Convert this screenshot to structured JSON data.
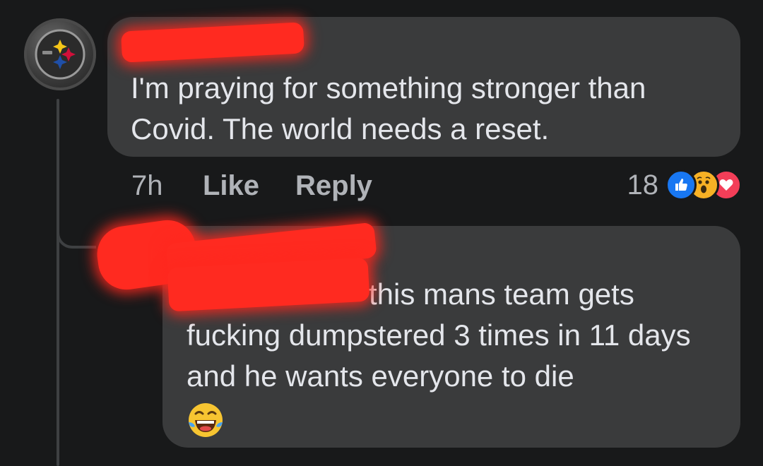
{
  "comment": {
    "author": "",
    "text": "I'm praying for something stronger than Covid. The world needs a reset.",
    "time": "7h",
    "like_label": "Like",
    "reply_label": "Reply",
    "reaction_count": "18",
    "reactions": [
      "like-icon",
      "wow-icon",
      "love-icon"
    ]
  },
  "reply": {
    "author": "",
    "mention": "",
    "text": "this mans team gets fucking dumpstered 3 times in 11 days and he wants everyone to die",
    "emoji": "laughing-tears-emoji"
  },
  "colors": {
    "background": "#18191a",
    "bubble": "#3a3b3c",
    "text": "#e4e6eb",
    "muted": "#b0b3b8",
    "redaction": "#ff2a20"
  }
}
